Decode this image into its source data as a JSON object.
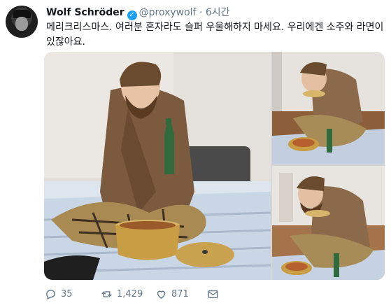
{
  "tweet": {
    "author_name": "Wolf Schröder",
    "handle": "@proxywolf",
    "separator": "·",
    "time": "6시간",
    "text": "메리크리스마스. 여러분 혼자라도 슬퍼 우울해하지 마세요. 우리에겐 소주와 라면이 있잖아요."
  },
  "actions": {
    "replies": "35",
    "retweets": "1,429",
    "likes": "871"
  },
  "icons": {
    "verified": "verified-badge-icon",
    "reply": "reply-icon",
    "retweet": "retweet-icon",
    "like": "heart-icon",
    "dm": "envelope-icon"
  },
  "colors": {
    "accent": "#1da1f2",
    "muted": "#657786",
    "text": "#14171a"
  }
}
